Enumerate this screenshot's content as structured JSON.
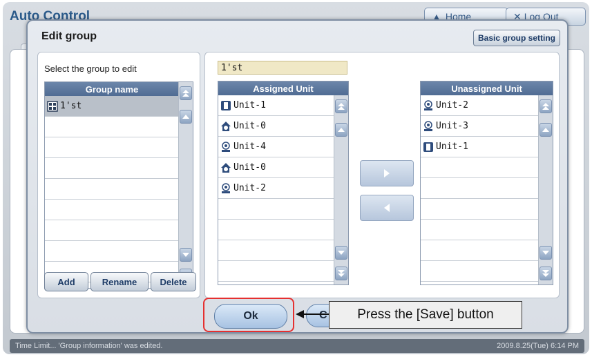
{
  "background": {
    "app_title": "Auto Control",
    "home_label": "Home",
    "logout_label": "Log Out"
  },
  "dialog": {
    "title": "Edit group",
    "basic_group_setting": "Basic group setting",
    "select_label": "Select the group to edit",
    "group_list": {
      "header": "Group name",
      "items": [
        {
          "icon": "group-icon",
          "label": "1'st",
          "selected": true
        }
      ],
      "empty_rows": 7
    },
    "buttons": {
      "add": "Add",
      "rename": "Rename",
      "delete": "Delete"
    },
    "selected_group_value": "1'st",
    "assigned": {
      "header": "Assigned Unit",
      "items": [
        {
          "icon": "indoor-unit-icon",
          "label": "Unit-1"
        },
        {
          "icon": "house-unit-icon",
          "label": "Unit-0"
        },
        {
          "icon": "ahu-unit-icon",
          "label": "Unit-4"
        },
        {
          "icon": "house-unit-icon",
          "label": "Unit-0"
        },
        {
          "icon": "ahu-unit-icon",
          "label": "Unit-2"
        }
      ]
    },
    "unassigned": {
      "header": "Unassigned Unit",
      "items": [
        {
          "icon": "ahu-unit-icon",
          "label": "Unit-2"
        },
        {
          "icon": "ahu-unit-icon",
          "label": "Unit-3"
        },
        {
          "icon": "indoor-unit-icon",
          "label": "Unit-1"
        }
      ]
    },
    "ok_label": "Ok",
    "cancel_label": "C"
  },
  "callout_text": "Press the [Save] button",
  "status_bar": {
    "left": "Time Limit... 'Group information' was edited.",
    "right": "2009.8.25(Tue)  6:14 PM"
  },
  "colors": {
    "header_blue": "#5f7aa0",
    "highlight_red": "#e53030",
    "input_bg": "#f0e8c6"
  }
}
